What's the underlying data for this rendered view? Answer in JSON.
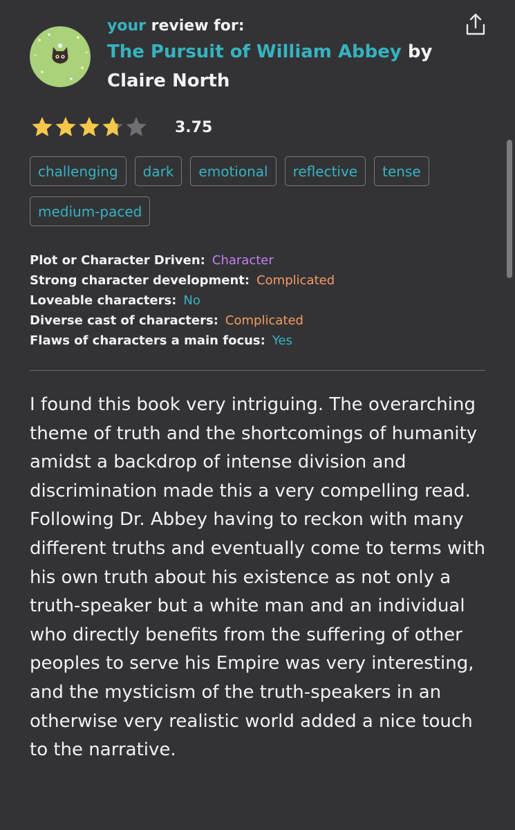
{
  "header": {
    "prefix_accent": "your",
    "prefix_rest": " review for:",
    "book_title": "The Pursuit of William Abbey",
    "by": " by",
    "author": "Claire North"
  },
  "rating": {
    "value": "3.75",
    "stars_filled": 3.75,
    "stars_total": 5
  },
  "moods": [
    "challenging",
    "dark",
    "emotional",
    "reflective",
    "tense",
    "medium-paced"
  ],
  "properties": [
    {
      "label": "Plot or Character Driven:",
      "value": "Character",
      "color": "#c67ef0"
    },
    {
      "label": "Strong character development:",
      "value": "Complicated",
      "color": "#f59a62"
    },
    {
      "label": "Loveable characters:",
      "value": "No",
      "color": "#35b3c0"
    },
    {
      "label": "Diverse cast of characters:",
      "value": "Complicated",
      "color": "#f59a62"
    },
    {
      "label": "Flaws of characters a main focus:",
      "value": "Yes",
      "color": "#35b3c0"
    }
  ],
  "review_text": "I found this book very intriguing. The overarching theme of truth and the shortcomings of humanity amidst a backdrop of intense division and discrimination made this a very compelling read. Following Dr. Abbey having to reckon with many different truths and eventually come to terms with his own truth about his existence as not only a truth-speaker but a white man and an individual who directly benefits from the suffering of other peoples to serve his Empire was very interesting, and the mysticism of the truth-speakers in an otherwise very realistic world added a nice touch to the narrative.",
  "colors": {
    "background": "#333336",
    "accent": "#35b3c0",
    "star_fill": "#f5c74a",
    "star_empty": "#6e6e72"
  },
  "icons": {
    "share": "share-icon",
    "avatar": "cat-avatar"
  }
}
